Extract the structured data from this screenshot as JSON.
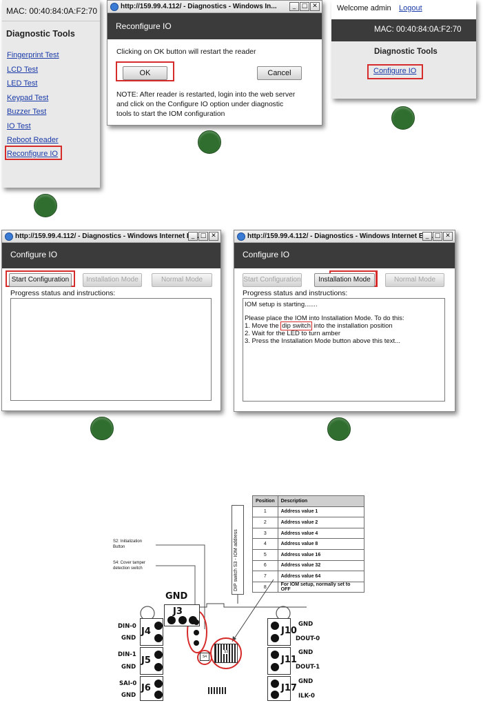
{
  "panel1": {
    "mac": "MAC: 00:40:84:0A:F2:70",
    "title": "Diagnostic Tools",
    "links": [
      "Fingerprint Test",
      "LCD Test",
      "LED Test",
      "Keypad Test",
      "Buzzer Test",
      "IO Test",
      "Reboot Reader",
      "Reconfigure IO"
    ]
  },
  "dialog1": {
    "window_title": "http://159.99.4.112/ - Diagnostics - Windows In...",
    "header": "Reconfigure IO",
    "message": "Clicking on OK button will restart the reader",
    "ok_label": "OK",
    "cancel_label": "Cancel",
    "note_line1": "NOTE: After reader is restarted, login into the web server",
    "note_line2": "and click on the Configure IO option under diagnostic",
    "note_line3": "tools to start the IOM configuration"
  },
  "panel3": {
    "welcome": "Welcome admin",
    "logout": "Logout",
    "mac": "MAC: 00:40:84:0A:F2:70",
    "title": "Diagnostic Tools",
    "link": "Configure IO"
  },
  "window4": {
    "window_title": "http://159.99.4.112/ - Diagnostics - Windows Internet Ex...",
    "header": "Configure IO",
    "start_label": "Start Configuration",
    "install_label": "Installation Mode",
    "normal_label": "Normal Mode",
    "progress_label": "Progress status and instructions:"
  },
  "window5": {
    "window_title": "http://159.99.4.112/ - Diagnostics - Windows Internet Ex...",
    "header": "Configure IO",
    "start_label": "Start Configuration",
    "install_label": "Installation Mode",
    "normal_label": "Normal Mode",
    "progress_label": "Progress status and instructions:",
    "line1": "IOM setup is starting.......",
    "line2": "Please place the IOM into Installation Mode. To do this:",
    "line3a": "1. Move the ",
    "line3b": "dip switch",
    "line3c": " into the installation position",
    "line4": "2. Wait for the LED to turn amber",
    "line5": "3. Press the Installation Mode button above this text..."
  },
  "table": {
    "headers": [
      "Position",
      "Description"
    ],
    "rows": [
      [
        "1",
        "Address value 1"
      ],
      [
        "2",
        "Address value 2"
      ],
      [
        "3",
        "Address value 4"
      ],
      [
        "4",
        "Address value 8"
      ],
      [
        "5",
        "Address value 16"
      ],
      [
        "6",
        "Address value 32"
      ],
      [
        "7",
        "Address value 64"
      ],
      [
        "8",
        "For IOM setup, normally set to OFF"
      ]
    ],
    "vertical_label": "DIP switch S3 - IOM address"
  },
  "board": {
    "s2_label_1": "S2: Initialization",
    "s2_label_2": "Button",
    "s4_label_1": "S4: Cover tamper",
    "s4_label_2": "detection switch",
    "gnd_top": "GND",
    "j3": "J3",
    "j4": "J4",
    "j5": "J5",
    "j6": "J6",
    "j10": "J10",
    "j11": "J11",
    "j17": "J17",
    "din0": "DIN-0",
    "gnd_a": "GND",
    "din1": "DIN-1",
    "gnd_b": "GND",
    "sai0": "SAI-0",
    "gnd_c": "GND",
    "gnd_r1": "GND",
    "dout0": "DOUT-0",
    "gnd_r2": "GND",
    "dout1": "DOUT-1",
    "gnd_r3": "GND",
    "ilk0": "ILK-0",
    "chip_s4": "S4",
    "chip_s3": "S3"
  },
  "colors": {
    "highlight": "#d62b2b",
    "step_dot": "#2f6e2e",
    "header_bg": "#3b3b3b"
  }
}
